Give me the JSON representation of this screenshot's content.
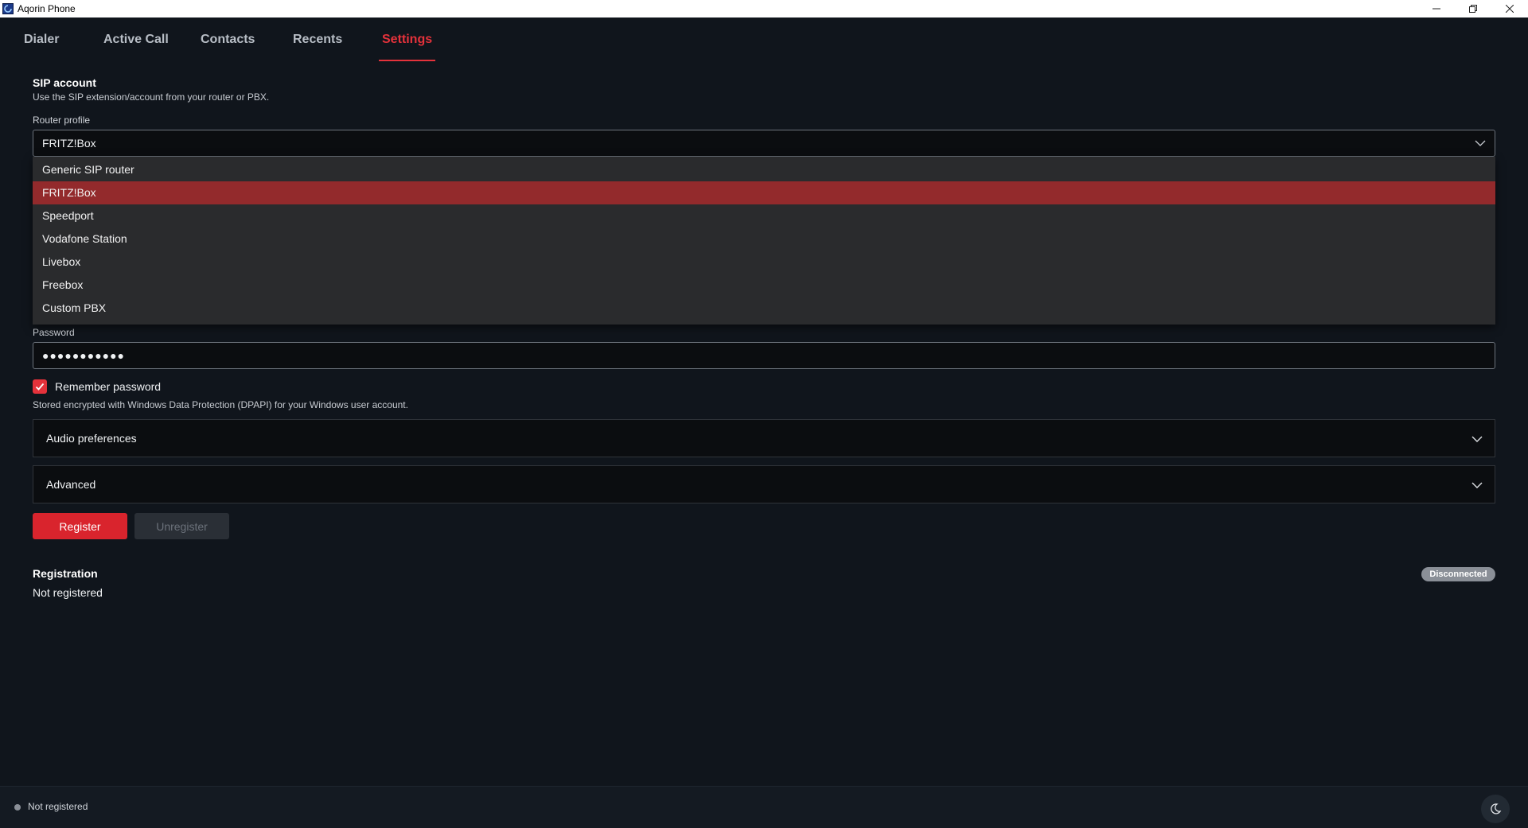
{
  "window": {
    "title": "Aqorin Phone",
    "controls": {
      "minimize": "—",
      "restore": "❐",
      "close": "✕"
    }
  },
  "tabs": [
    {
      "label": "Dialer",
      "active": false
    },
    {
      "label": "Active Call",
      "active": false
    },
    {
      "label": "Contacts",
      "active": false
    },
    {
      "label": "Recents",
      "active": false
    },
    {
      "label": "Settings",
      "active": true
    }
  ],
  "sip": {
    "title": "SIP account",
    "subtitle": "Use the SIP extension/account from your router or PBX.",
    "router_profile_label": "Router profile",
    "router_profile_value": "FRITZ!Box",
    "options": [
      "Generic SIP router",
      "FRITZ!Box",
      "Speedport",
      "Vodafone Station",
      "Livebox",
      "Freebox",
      "Custom PBX"
    ],
    "selected_index": 1,
    "password_label": "Password",
    "password_value": "●●●●●●●●●●●",
    "remember_label": "Remember password",
    "remember_checked": true,
    "remember_note": "Stored encrypted with Windows Data Protection (DPAPI) for your Windows user account."
  },
  "accordions": {
    "audio": "Audio preferences",
    "advanced": "Advanced"
  },
  "buttons": {
    "register": "Register",
    "unregister": "Unregister"
  },
  "registration": {
    "title": "Registration",
    "status": "Not registered",
    "badge": "Disconnected"
  },
  "statusbar": {
    "text": "Not registered"
  },
  "colors": {
    "accent": "#e5323b",
    "selected_option": "#932a2c",
    "background": "#10151c"
  }
}
